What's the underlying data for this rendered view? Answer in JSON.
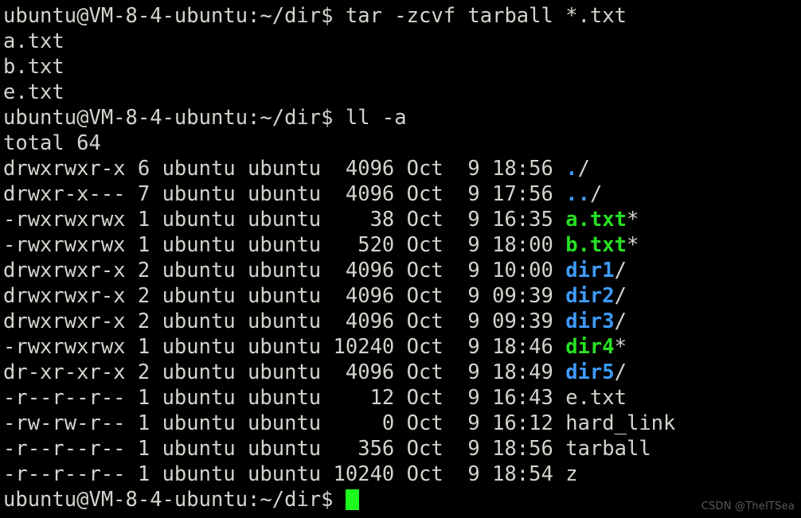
{
  "terminal": {
    "title": "ubuntu@VM-8-4-ubuntu: ~/dir",
    "colors": {
      "background": "#000000",
      "foreground": "#d6d3cd",
      "directory": "#3e9bfa",
      "executable": "#26e024",
      "cursor": "#1dfa1d",
      "watermark": "#5a5a5a"
    },
    "prompt": "ubuntu@VM-8-4-ubuntu:~/dir$ ",
    "commands": [
      "tar -zcvf tarball *.txt",
      "ll -a"
    ],
    "tar_output": [
      "a.txt",
      "b.txt",
      "e.txt"
    ],
    "total_line": "total 64",
    "columns": [
      "perms",
      "links",
      "owner",
      "group",
      "size",
      "month",
      "day",
      "time",
      "name"
    ],
    "listing": [
      {
        "perms": "drwxrwxr-x",
        "links": "6",
        "owner": "ubuntu",
        "group": "ubuntu",
        "size": "4096",
        "month": "Oct",
        "day": "9",
        "time": "18:56",
        "name": "./",
        "base": ".",
        "suffix": "/",
        "type": "dir"
      },
      {
        "perms": "drwxr-x---",
        "links": "7",
        "owner": "ubuntu",
        "group": "ubuntu",
        "size": "4096",
        "month": "Oct",
        "day": "9",
        "time": "17:56",
        "name": "../",
        "base": "..",
        "suffix": "/",
        "type": "dir"
      },
      {
        "perms": "-rwxrwxrwx",
        "links": "1",
        "owner": "ubuntu",
        "group": "ubuntu",
        "size": "38",
        "month": "Oct",
        "day": "9",
        "time": "16:35",
        "name": "a.txt*",
        "base": "a.txt",
        "suffix": "*",
        "type": "exec"
      },
      {
        "perms": "-rwxrwxrwx",
        "links": "1",
        "owner": "ubuntu",
        "group": "ubuntu",
        "size": "520",
        "month": "Oct",
        "day": "9",
        "time": "18:00",
        "name": "b.txt*",
        "base": "b.txt",
        "suffix": "*",
        "type": "exec"
      },
      {
        "perms": "drwxrwxr-x",
        "links": "2",
        "owner": "ubuntu",
        "group": "ubuntu",
        "size": "4096",
        "month": "Oct",
        "day": "9",
        "time": "10:00",
        "name": "dir1/",
        "base": "dir1",
        "suffix": "/",
        "type": "dir"
      },
      {
        "perms": "drwxrwxr-x",
        "links": "2",
        "owner": "ubuntu",
        "group": "ubuntu",
        "size": "4096",
        "month": "Oct",
        "day": "9",
        "time": "09:39",
        "name": "dir2/",
        "base": "dir2",
        "suffix": "/",
        "type": "dir"
      },
      {
        "perms": "drwxrwxr-x",
        "links": "2",
        "owner": "ubuntu",
        "group": "ubuntu",
        "size": "4096",
        "month": "Oct",
        "day": "9",
        "time": "09:39",
        "name": "dir3/",
        "base": "dir3",
        "suffix": "/",
        "type": "dir"
      },
      {
        "perms": "-rwxrwxrwx",
        "links": "1",
        "owner": "ubuntu",
        "group": "ubuntu",
        "size": "10240",
        "month": "Oct",
        "day": "9",
        "time": "18:46",
        "name": "dir4*",
        "base": "dir4",
        "suffix": "*",
        "type": "exec"
      },
      {
        "perms": "dr-xr-xr-x",
        "links": "2",
        "owner": "ubuntu",
        "group": "ubuntu",
        "size": "4096",
        "month": "Oct",
        "day": "9",
        "time": "18:49",
        "name": "dir5/",
        "base": "dir5",
        "suffix": "/",
        "type": "dir"
      },
      {
        "perms": "-r--r--r--",
        "links": "1",
        "owner": "ubuntu",
        "group": "ubuntu",
        "size": "12",
        "month": "Oct",
        "day": "9",
        "time": "16:43",
        "name": "e.txt",
        "base": "e.txt",
        "suffix": "",
        "type": "file"
      },
      {
        "perms": "-rw-rw-r--",
        "links": "1",
        "owner": "ubuntu",
        "group": "ubuntu",
        "size": "0",
        "month": "Oct",
        "day": "9",
        "time": "16:12",
        "name": "hard_link",
        "base": "hard_link",
        "suffix": "",
        "type": "file"
      },
      {
        "perms": "-r--r--r--",
        "links": "1",
        "owner": "ubuntu",
        "group": "ubuntu",
        "size": "356",
        "month": "Oct",
        "day": "9",
        "time": "18:56",
        "name": "tarball",
        "base": "tarball",
        "suffix": "",
        "type": "file"
      },
      {
        "perms": "-r--r--r--",
        "links": "1",
        "owner": "ubuntu",
        "group": "ubuntu",
        "size": "10240",
        "month": "Oct",
        "day": "9",
        "time": "18:54",
        "name": "z",
        "base": "z",
        "suffix": "",
        "type": "file"
      }
    ],
    "watermark": "CSDN @TheITSea"
  }
}
